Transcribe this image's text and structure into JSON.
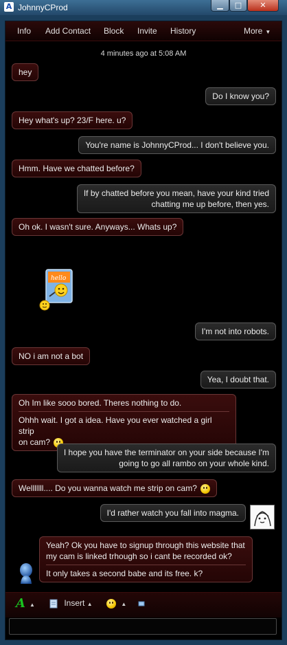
{
  "window": {
    "title": "JohnnyCProd",
    "app_icon_letter": "A"
  },
  "menubar": {
    "items": [
      "Info",
      "Add Contact",
      "Block",
      "Invite",
      "History"
    ],
    "more_label": "More"
  },
  "conversation": {
    "timestamp": "4 minutes ago at 5:08 AM",
    "messages": [
      {
        "from": "them",
        "text": "hey"
      },
      {
        "from": "me",
        "text": "Do I know you?"
      },
      {
        "from": "them",
        "text": "Hey what's up? 23/F here. u?"
      },
      {
        "from": "me",
        "text": "You're name is JohnnyCProd... I don't believe you."
      },
      {
        "from": "them",
        "text": "Hmm. Have we chatted before?"
      },
      {
        "from": "me",
        "line1": "If by chatted before you mean, have your kind tried",
        "line2": "chatting me up before, then yes."
      },
      {
        "from": "them",
        "text": "Oh ok. I wasn't sure. Anyways... Whats up?"
      },
      {
        "from": "them",
        "type": "wink",
        "caption": "hello"
      },
      {
        "from": "me",
        "text": "I'm not into robots."
      },
      {
        "from": "them",
        "text": "NO i am not a bot"
      },
      {
        "from": "me",
        "text": "Yea, I doubt that."
      },
      {
        "from": "them",
        "seg1": "Oh Im like sooo bored. Theres nothing to do.",
        "seg2_line1": "Ohhh wait. I got a idea. Have you ever watched a girl strip",
        "seg2_line2": "on cam?"
      },
      {
        "from": "me",
        "line1": "I hope you have the terminator on your side because I'm",
        "line2": "going to go all rambo on your whole kind."
      },
      {
        "from": "them",
        "text": "Welllllll.... Do you wanna watch me strip on cam?"
      },
      {
        "from": "me",
        "text": "I'd rather watch you fall into magma."
      },
      {
        "from": "them",
        "seg1_line1": "Yeah? Ok you have to signup through this website that",
        "seg1_line2": "my cam is linked trhough so i cant be recorded ok?",
        "seg2": "It only takes a second babe and its free. k?"
      }
    ]
  },
  "toolbar": {
    "insert_label": "Insert",
    "font_glyph": "A"
  },
  "compose": {
    "value": ""
  },
  "colors": {
    "accent_red": "#2b0a0a",
    "font_green": "#19c21f",
    "bubble_border": "#5d5d5d"
  }
}
